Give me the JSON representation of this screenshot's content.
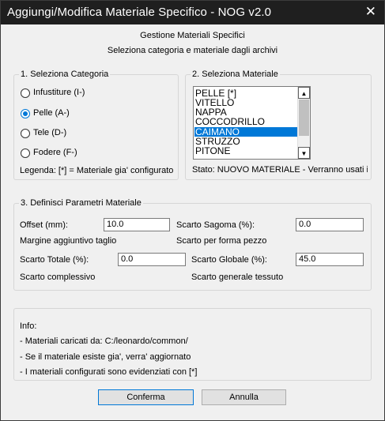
{
  "window": {
    "title": "Aggiungi/Modifica Materiale Specifico - NOG v2.0",
    "close_glyph": "✕"
  },
  "header": {
    "line1": "Gestione Materiali Specifici",
    "line2": "Seleziona categoria e materiale dagli archivi"
  },
  "category": {
    "title": "1. Seleziona Categoria",
    "options": [
      "Infustiture (I-)",
      "Pelle (A-)",
      "Tele (D-)",
      "Fodere (F-)"
    ],
    "selected": "Pelle (A-)",
    "legend": "Legenda: [*] = Materiale gia' configurato"
  },
  "material": {
    "title": "2. Seleziona Materiale",
    "items": [
      "PELLE [*]",
      "VITELLO",
      "NAPPA",
      "COCCODRILLO",
      "CAIMANO",
      "STRUZZO",
      "PITONE"
    ],
    "selected": "CAIMANO",
    "status": "Stato: NUOVO MATERIALE - Verranno usati i"
  },
  "params": {
    "title": "3. Definisci Parametri Materiale",
    "offset_label": "Offset (mm):",
    "offset_value": "10.0",
    "offset_help": "Margine aggiuntivo taglio",
    "sagoma_label": "Scarto Sagoma (%):",
    "sagoma_value": "0.0",
    "sagoma_help": "Scarto per forma pezzo",
    "totale_label": "Scarto Totale (%):",
    "totale_value": "0.0",
    "totale_help": "Scarto complessivo",
    "globale_label": "Scarto Globale (%):",
    "globale_value": "45.0",
    "globale_help": "Scarto generale tessuto"
  },
  "info": {
    "title": "Info:",
    "lines": [
      "- Materiali caricati da: C:/leonardo/common/",
      "- Se il materiale esiste gia', verra' aggiornato",
      "- I materiali configurati sono evidenziati con [*]"
    ]
  },
  "buttons": {
    "confirm": "Conferma",
    "cancel": "Annulla"
  },
  "colors": {
    "accent": "#0078d7",
    "titlebar": "#1f1f1f",
    "background": "#f0f0f0"
  },
  "icons": {
    "close": "close-icon",
    "scroll_up": "chevron-up-icon",
    "scroll_down": "chevron-down-icon"
  }
}
